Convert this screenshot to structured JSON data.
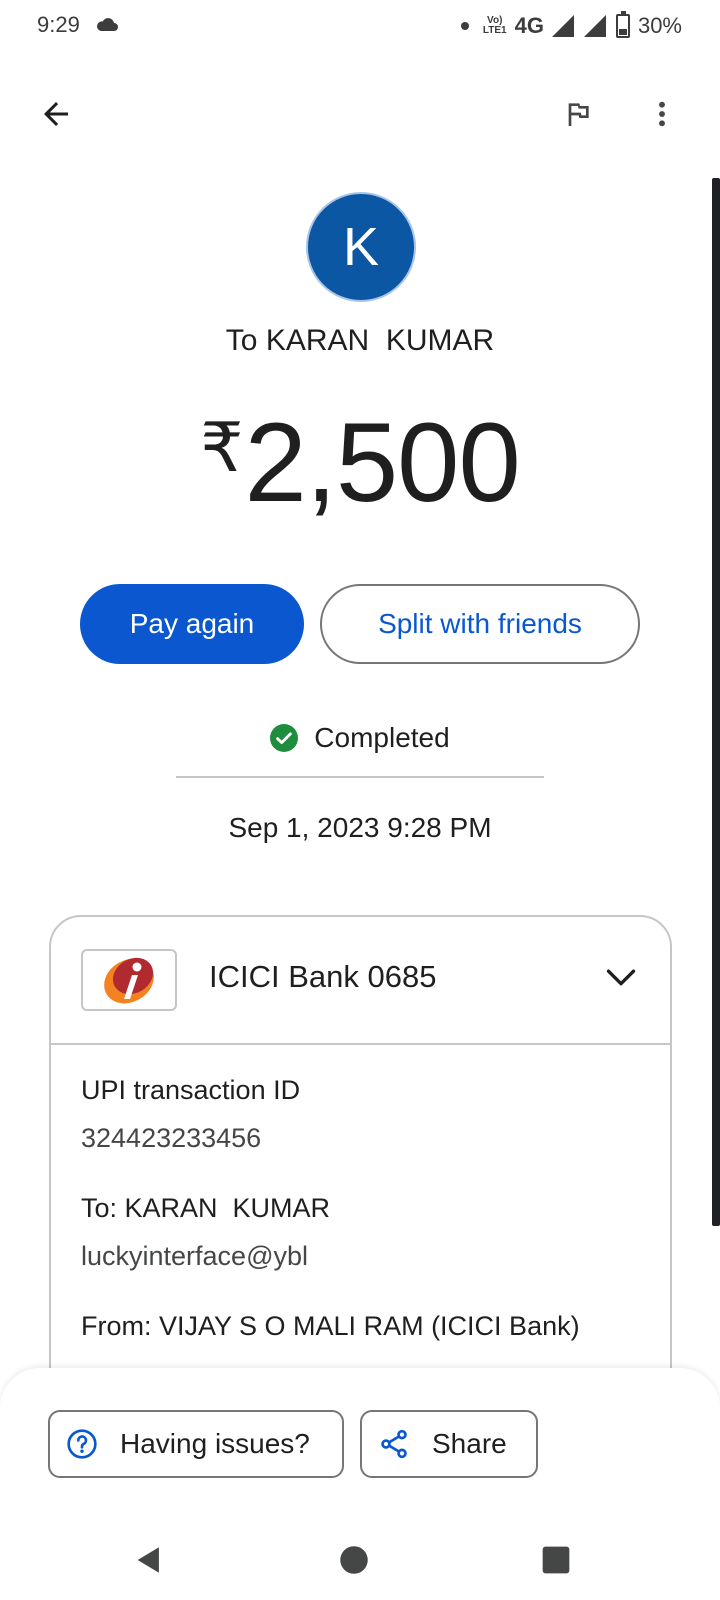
{
  "status_bar": {
    "time": "9:29",
    "network": "4G",
    "volte": "VoLTE",
    "battery": "30%",
    "battery_level": 0.3
  },
  "header": {
    "avatar_letter": "K",
    "recipient": "To KARAN  KUMAR",
    "currency_symbol": "₹",
    "amount": "2,500"
  },
  "actions": {
    "pay_again": "Pay again",
    "split": "Split with friends"
  },
  "transaction": {
    "status": "Completed",
    "datetime": "Sep 1, 2023 9:28 PM"
  },
  "card": {
    "bank": "ICICI Bank 0685",
    "upi_label": "UPI transaction ID",
    "upi_value": "324423233456",
    "to_label": "To: KARAN  KUMAR",
    "to_value": "luckyinterface@ybl",
    "from_label": "From: VIJAY S O MALI RAM (ICICI Bank)"
  },
  "bottom_actions": {
    "issues": "Having issues?",
    "share": "Share"
  },
  "colors": {
    "primary": "#0b57d0",
    "avatar": "#0b57a4",
    "success": "#1e8e3e",
    "icici_red": "#b02a30",
    "icici_orange": "#f58220"
  }
}
